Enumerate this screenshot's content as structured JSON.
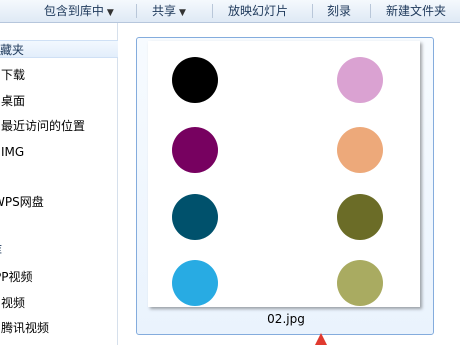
{
  "toolbar": {
    "include_library": "包含到库中",
    "share": "共享",
    "slideshow": "放映幻灯片",
    "burn": "刻录",
    "new_folder": "新建文件夹"
  },
  "sidebar": {
    "items": [
      {
        "label": "收藏夹"
      },
      {
        "label": "下载"
      },
      {
        "label": "桌面"
      },
      {
        "label": "最近访问的位置"
      },
      {
        "label": "IMG"
      },
      {
        "label": "WPS网盘"
      },
      {
        "label": "库"
      },
      {
        "label": "PP视频"
      },
      {
        "label": "视频"
      },
      {
        "label": "腾讯视频"
      }
    ]
  },
  "file": {
    "name": "02.jpg",
    "dot_colors": [
      "#000000",
      "#daa2d2",
      "#770160",
      "#eda97a",
      "#00516c",
      "#6b6c27",
      "#28abe3",
      "#a9ab61"
    ]
  }
}
